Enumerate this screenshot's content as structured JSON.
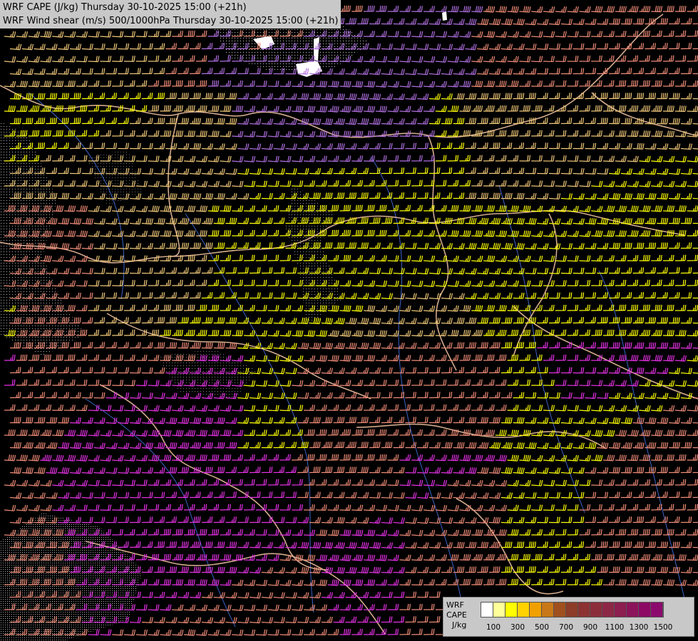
{
  "titles": {
    "line1": "WRF CAPE (J/kg) Thursday 30-10-2025 15:00 (+21h)",
    "line2": "WRF Wind shear (m/s) 500/1000hPa Thursday 30-10-2025 15:00 (+21h)"
  },
  "legend": {
    "label_lines": [
      "WRF",
      "CAPE",
      "J/kg"
    ],
    "colors": [
      "#ffffff",
      "#ffff99",
      "#ffff00",
      "#ffd200",
      "#f0a000",
      "#c87818",
      "#a0501e",
      "#8c3c28",
      "#8c3232",
      "#8c2d3c",
      "#8c2846",
      "#8c1e50",
      "#8c145a",
      "#8c0a64",
      "#8c0a6e"
    ],
    "ticks": [
      "100",
      "300",
      "500",
      "700",
      "900",
      "1100",
      "1300",
      "1500"
    ]
  },
  "barb_colors": {
    "yellow": "#ffff00",
    "tan": "#f0c878",
    "salmon": "#f08c78",
    "pink": "#e07090",
    "magenta": "#e632e6",
    "violet": "#b070e0",
    "brown": "#c89664"
  },
  "map_colors": {
    "background": "#000000",
    "borders": "#d2aa8c",
    "rivers": "#3c64c8",
    "terrain_dots": "#ffffff",
    "snow": "#ffffff"
  }
}
